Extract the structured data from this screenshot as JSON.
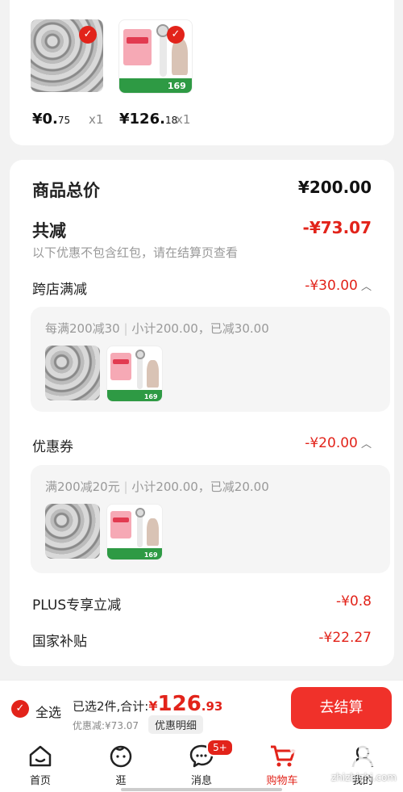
{
  "items": [
    {
      "price_main": "¥0.",
      "price_cents": "75",
      "qty": "x1",
      "image": "coins-image"
    },
    {
      "price_main": "¥126.",
      "price_cents": "18",
      "qty": "x1",
      "image": "hair-dryer-image"
    }
  ],
  "summary": {
    "total_label": "商品总价",
    "total_value": "¥200.00",
    "reduce_label": "共减",
    "reduce_value": "-¥73.07",
    "note": "以下优惠不包含红包，请在结算页查看",
    "cross_store_label": "跨店满减",
    "cross_store_value": "-¥30.00",
    "cross_store_rule": "每满200减30",
    "cross_store_detail": "小计200.00，已减30.00",
    "coupon_label": "优惠券",
    "coupon_value": "-¥20.00",
    "coupon_rule": "满200减20元",
    "coupon_detail": "小计200.00，已减20.00",
    "plus_label": "PLUS专享立减",
    "plus_value": "-¥0.8",
    "subsidy_label": "国家补贴",
    "subsidy_value": "-¥22.27"
  },
  "checkout": {
    "select_all": "全选",
    "selected_text": "已选2件,合计:",
    "total_symbol": "¥",
    "total_main": "126",
    "total_cents": ".93",
    "discount_text": "优惠减:¥73.07",
    "discount_detail_button": "优惠明细",
    "checkout_button": "去结算"
  },
  "nav": {
    "home": "首页",
    "browse": "逛",
    "messages": "消息",
    "messages_badge": "5+",
    "cart": "购物车",
    "me": "我的"
  },
  "colors": {
    "accent": "#e2231a",
    "button": "#f0312a"
  },
  "watermark": "zhizhizhi.com"
}
